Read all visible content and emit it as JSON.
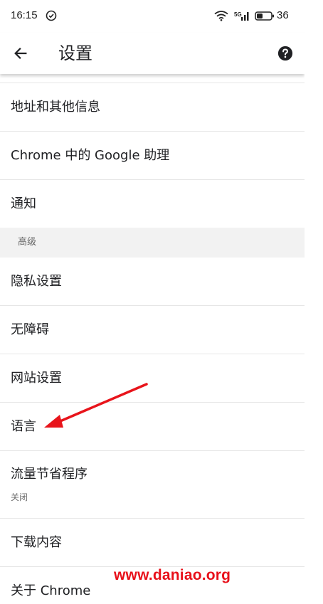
{
  "status_bar": {
    "time": "16:15",
    "battery_level": "36",
    "icons": [
      "alarm-icon",
      "wifi-icon",
      "signal-icon",
      "battery-icon"
    ]
  },
  "app_bar": {
    "title": "设置",
    "back_icon": "arrow-back-icon",
    "help_icon": "help-circle-icon"
  },
  "settings": {
    "items_basic": [
      {
        "label": "地址和其他信息"
      },
      {
        "label": "Chrome 中的 Google 助理"
      },
      {
        "label": "通知"
      }
    ],
    "advanced_header": "高级",
    "items_advanced": [
      {
        "label": "隐私设置"
      },
      {
        "label": "无障碍"
      },
      {
        "label": "网站设置"
      },
      {
        "label": "语言"
      },
      {
        "label": "流量节省程序",
        "sublabel": "关闭"
      },
      {
        "label": "下载内容"
      },
      {
        "label": "关于 Chrome"
      }
    ]
  },
  "annotation": {
    "arrow_color": "#e8141b"
  },
  "watermark": {
    "text": "www.daniao.org",
    "color": "#e8101a"
  },
  "colors": {
    "background": "#ffffff",
    "divider": "#e6e6e6",
    "section_bg": "#f2f2f2",
    "text_primary": "#202124",
    "text_secondary": "#6f6f6f"
  }
}
